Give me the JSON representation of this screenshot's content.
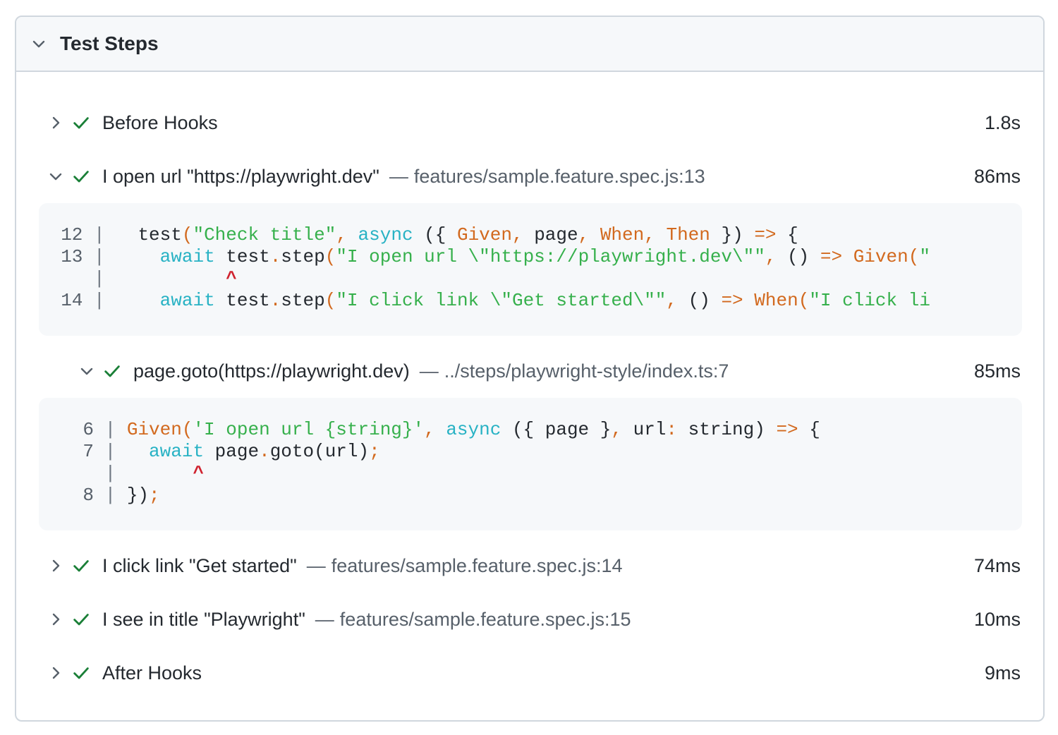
{
  "panel": {
    "title": "Test Steps"
  },
  "steps": [
    {
      "title": "Before Hooks",
      "sep": "",
      "location": "",
      "duration": "1.8s",
      "status": "passed",
      "expanded": false
    },
    {
      "title": "I open url \"https://playwright.dev\"",
      "sep": "—",
      "location": "features/sample.feature.spec.js:13",
      "duration": "86ms",
      "status": "passed",
      "expanded": true
    },
    {
      "title": "page.goto(https://playwright.dev)",
      "sep": "—",
      "location": "../steps/playwright-style/index.ts:7",
      "duration": "85ms",
      "status": "passed",
      "expanded": true
    },
    {
      "title": "I click link \"Get started\"",
      "sep": "—",
      "location": "features/sample.feature.spec.js:14",
      "duration": "74ms",
      "status": "passed",
      "expanded": false
    },
    {
      "title": "I see in title \"Playwright\"",
      "sep": "—",
      "location": "features/sample.feature.spec.js:15",
      "duration": "10ms",
      "status": "passed",
      "expanded": false
    },
    {
      "title": "After Hooks",
      "sep": "",
      "location": "",
      "duration": "9ms",
      "status": "passed",
      "expanded": false
    }
  ],
  "code_blocks": [
    {
      "lines": [
        {
          "num": "12",
          "tokens": [
            [
              "",
              "  test"
            ],
            [
              "org",
              "("
            ],
            [
              "str",
              "\"Check title\""
            ],
            [
              "org",
              ","
            ],
            [
              "",
              " "
            ],
            [
              "kw",
              "async"
            ],
            [
              "",
              " ({ "
            ],
            [
              "org",
              "Given"
            ],
            [
              "org",
              ","
            ],
            [
              "",
              " page"
            ],
            [
              "org",
              ","
            ],
            [
              "",
              " "
            ],
            [
              "org",
              "When"
            ],
            [
              "org",
              ","
            ],
            [
              "",
              " "
            ],
            [
              "org",
              "Then"
            ],
            [
              "",
              " }) "
            ],
            [
              "org",
              "=>"
            ],
            [
              "",
              " {"
            ]
          ]
        },
        {
          "num": "13",
          "tokens": [
            [
              "",
              "    "
            ],
            [
              "kw",
              "await"
            ],
            [
              "",
              " test"
            ],
            [
              "org",
              "."
            ],
            [
              "",
              "step"
            ],
            [
              "org",
              "("
            ],
            [
              "str",
              "\"I open url \\\"https://playwright.dev\\\"\""
            ],
            [
              "org",
              ","
            ],
            [
              "",
              " () "
            ],
            [
              "org",
              "=>"
            ],
            [
              "",
              " "
            ],
            [
              "org",
              "Given"
            ],
            [
              "org",
              "("
            ],
            [
              "str",
              "\""
            ]
          ]
        },
        {
          "num": "",
          "caret_pad": "          ",
          "caret": "^"
        },
        {
          "num": "14",
          "tokens": [
            [
              "",
              "    "
            ],
            [
              "kw",
              "await"
            ],
            [
              "",
              " test"
            ],
            [
              "org",
              "."
            ],
            [
              "",
              "step"
            ],
            [
              "org",
              "("
            ],
            [
              "str",
              "\"I click link \\\"Get started\\\"\""
            ],
            [
              "org",
              ","
            ],
            [
              "",
              " () "
            ],
            [
              "org",
              "=>"
            ],
            [
              "",
              " "
            ],
            [
              "org",
              "When"
            ],
            [
              "org",
              "("
            ],
            [
              "str",
              "\"I click li"
            ]
          ]
        }
      ]
    },
    {
      "lines": [
        {
          "num": "6",
          "tokens": [
            [
              "org",
              "Given"
            ],
            [
              "org",
              "("
            ],
            [
              "str",
              "'I open url {string}'"
            ],
            [
              "org",
              ","
            ],
            [
              "",
              " "
            ],
            [
              "kw",
              "async"
            ],
            [
              "",
              " ({ page }"
            ],
            [
              "org",
              ","
            ],
            [
              "",
              " url"
            ],
            [
              "org",
              ":"
            ],
            [
              "",
              " string) "
            ],
            [
              "org",
              "=>"
            ],
            [
              "",
              " {"
            ]
          ]
        },
        {
          "num": "7",
          "tokens": [
            [
              "",
              "  "
            ],
            [
              "kw",
              "await"
            ],
            [
              "",
              " page"
            ],
            [
              "org",
              "."
            ],
            [
              "",
              "goto(url)"
            ],
            [
              "org",
              ";"
            ]
          ]
        },
        {
          "num": "",
          "caret_pad": "      ",
          "caret": "^"
        },
        {
          "num": "8",
          "tokens": [
            [
              "",
              "})"
            ],
            [
              "org",
              ";"
            ]
          ]
        }
      ]
    }
  ],
  "colors": {
    "check": "#1a7f37",
    "keyword": "#28b2c4",
    "string": "#36b04c",
    "punct": "#d2691e",
    "caret": "#cf222e"
  },
  "icons": {
    "collapse": "chevron-down-icon",
    "expand": "chevron-right-icon",
    "status": "check-icon"
  }
}
